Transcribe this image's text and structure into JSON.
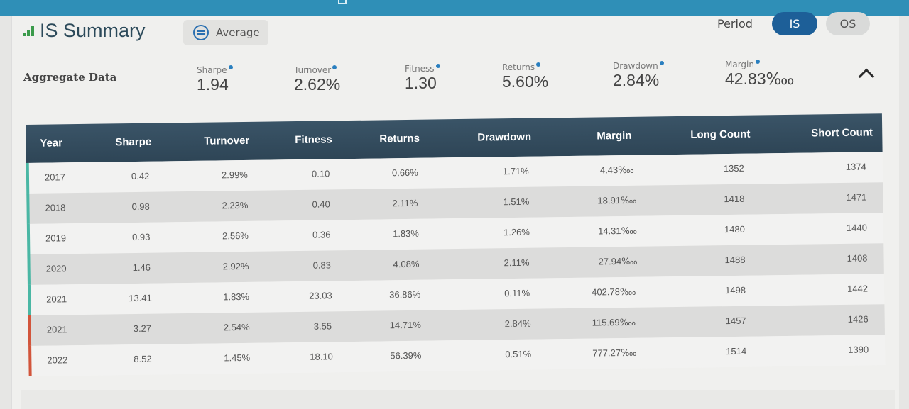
{
  "header": {
    "title": "IS Summary",
    "average_label": "Average",
    "period_label": "Period",
    "is_label": "IS",
    "os_label": "OS",
    "icons": {
      "title_icon": "bar-chart-icon",
      "average_icon": "list-circle-icon",
      "collapse_icon": "chevron-up-icon"
    }
  },
  "aggregate": {
    "label": "Aggregate Data",
    "metrics": [
      {
        "name": "Sharpe",
        "value": "1.94"
      },
      {
        "name": "Turnover",
        "value": "2.62%"
      },
      {
        "name": "Fitness",
        "value": "1.30"
      },
      {
        "name": "Returns",
        "value": "5.60%"
      },
      {
        "name": "Drawdown",
        "value": "2.84%"
      },
      {
        "name": "Margin",
        "value": "42.83‱"
      }
    ]
  },
  "table": {
    "columns": [
      "Year",
      "Sharpe",
      "Turnover",
      "Fitness",
      "Returns",
      "Drawdown",
      "Margin",
      "Long Count",
      "Short Count"
    ],
    "rows": [
      {
        "year": "2017",
        "sharpe": "0.42",
        "turnover": "2.99%",
        "fitness": "0.10",
        "returns": "0.66%",
        "drawdown": "1.71%",
        "margin": "4.43‱",
        "long": "1352",
        "short": "1374"
      },
      {
        "year": "2018",
        "sharpe": "0.98",
        "turnover": "2.23%",
        "fitness": "0.40",
        "returns": "2.11%",
        "drawdown": "1.51%",
        "margin": "18.91‱",
        "long": "1418",
        "short": "1471"
      },
      {
        "year": "2019",
        "sharpe": "0.93",
        "turnover": "2.56%",
        "fitness": "0.36",
        "returns": "1.83%",
        "drawdown": "1.26%",
        "margin": "14.31‱",
        "long": "1480",
        "short": "1440"
      },
      {
        "year": "2020",
        "sharpe": "1.46",
        "turnover": "2.92%",
        "fitness": "0.83",
        "returns": "4.08%",
        "drawdown": "2.11%",
        "margin": "27.94‱",
        "long": "1488",
        "short": "1408"
      },
      {
        "year": "2021",
        "sharpe": "13.41",
        "turnover": "1.83%",
        "fitness": "23.03",
        "returns": "36.86%",
        "drawdown": "0.11%",
        "margin": "402.78‱",
        "long": "1498",
        "short": "1442"
      },
      {
        "year": "2021",
        "sharpe": "3.27",
        "turnover": "2.54%",
        "fitness": "3.55",
        "returns": "14.71%",
        "drawdown": "2.84%",
        "margin": "115.69‱",
        "long": "1457",
        "short": "1426"
      },
      {
        "year": "2022",
        "sharpe": "8.52",
        "turnover": "1.45%",
        "fitness": "18.10",
        "returns": "56.39%",
        "drawdown": "0.51%",
        "margin": "777.27‱",
        "long": "1514",
        "short": "1390"
      }
    ]
  },
  "colors": {
    "header_bg": "#2e4556",
    "is_pill": "#1d5f98",
    "row_marker_green": "#4ab7a4",
    "row_marker_red": "#d2553b",
    "title_icon_green": "#3a9a4a"
  }
}
